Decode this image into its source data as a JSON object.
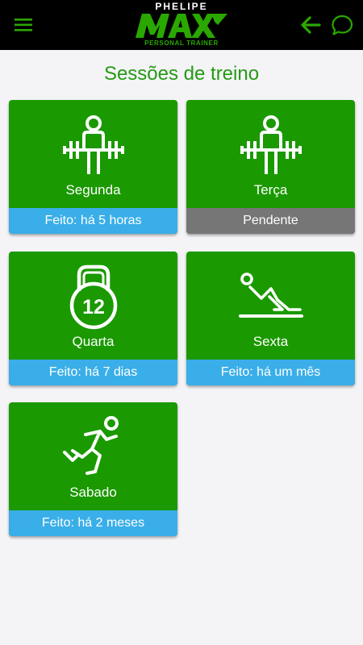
{
  "header": {
    "logo_top": "PHELIPE",
    "logo_main": "MAX",
    "logo_sub": "PERSONAL TRAINER",
    "icons": [
      "menu-icon",
      "back-arrow-icon",
      "chat-icon"
    ],
    "accent": "#2aa800"
  },
  "main": {
    "title": "Sessões de treino",
    "sessions": [
      {
        "day": "Segunda",
        "status": "Feito: há 5 horas",
        "state": "done",
        "icon": "weightlifter-icon"
      },
      {
        "day": "Terça",
        "status": "Pendente",
        "state": "pending",
        "icon": "weightlifter-icon"
      },
      {
        "day": "Quarta",
        "status": "Feito: há 7 dias",
        "state": "done",
        "icon": "kettlebell-icon",
        "icon_text": "12"
      },
      {
        "day": "Sexta",
        "status": "Feito: há um mês",
        "state": "done",
        "icon": "stretching-icon"
      },
      {
        "day": "Sabado",
        "status": "Feito: há 2 meses",
        "state": "done",
        "icon": "running-icon"
      }
    ]
  },
  "colors": {
    "card_green": "#1a9900",
    "done_blue": "#3aaee8",
    "pending_gray": "#767676",
    "title_green": "#249a12",
    "background": "#f4f4f7"
  }
}
